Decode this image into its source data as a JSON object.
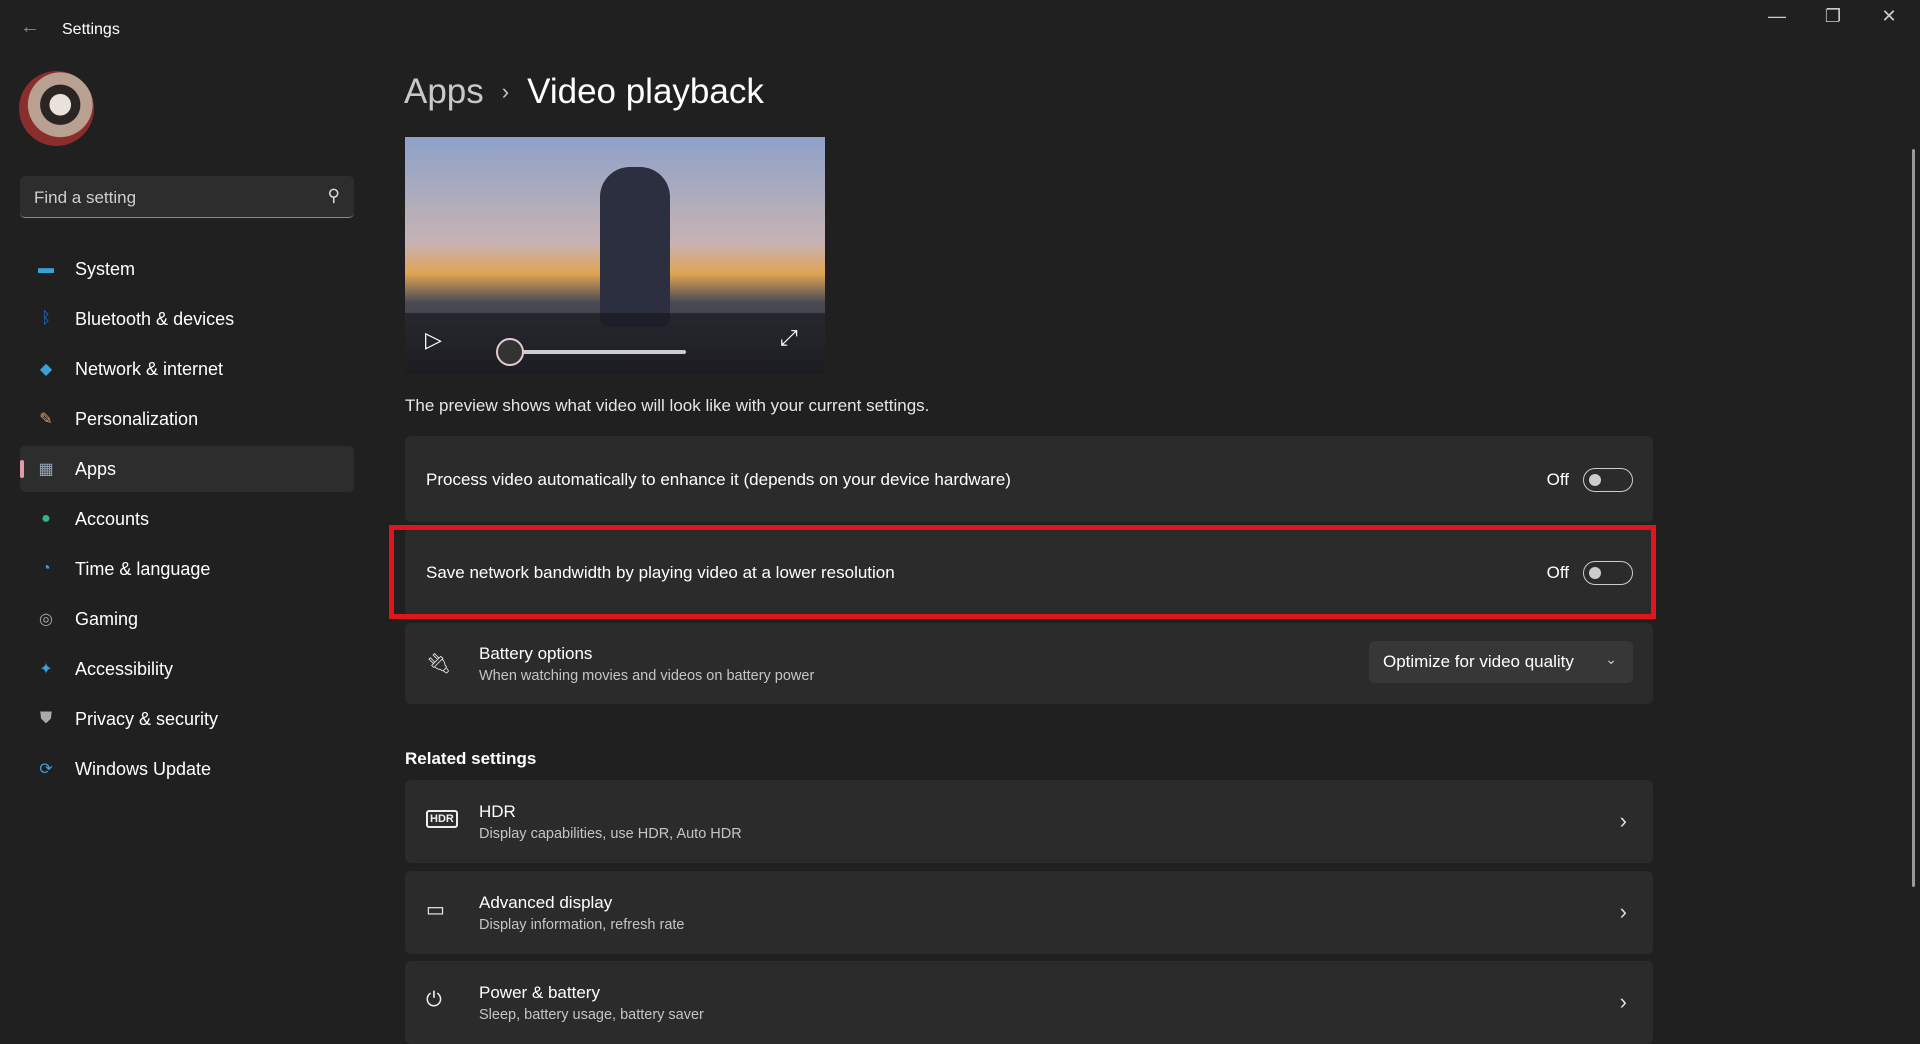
{
  "window": {
    "title": "Settings",
    "minimize": "—",
    "restore": "❐",
    "close": "✕"
  },
  "search": {
    "placeholder": "Find a setting"
  },
  "sidebar": {
    "items": [
      {
        "label": "System",
        "icon": "▬",
        "color": "#3aa0d8"
      },
      {
        "label": "Bluetooth & devices",
        "icon": "ᛒ",
        "color": "#1a73e8"
      },
      {
        "label": "Network & internet",
        "icon": "◆",
        "color": "#3aa0d8"
      },
      {
        "label": "Personalization",
        "icon": "✎",
        "color": "#e0a060"
      },
      {
        "label": "Apps",
        "icon": "▦",
        "color": "#9aa7b8"
      },
      {
        "label": "Accounts",
        "icon": "●",
        "color": "#36b38a"
      },
      {
        "label": "Time & language",
        "icon": "◔",
        "color": "#3aa0d8"
      },
      {
        "label": "Gaming",
        "icon": "◎",
        "color": "#aaaaaa"
      },
      {
        "label": "Accessibility",
        "icon": "✦",
        "color": "#3aa0d8"
      },
      {
        "label": "Privacy & security",
        "icon": "⛊",
        "color": "#aaaaaa"
      },
      {
        "label": "Windows Update",
        "icon": "⟳",
        "color": "#3aa0d8"
      }
    ],
    "selected": "Apps"
  },
  "breadcrumb": {
    "parent": "Apps",
    "current": "Video playback"
  },
  "video": {
    "progress": 0
  },
  "caption": "The preview shows what video will look like with your current settings.",
  "settings": [
    {
      "label": "Process video automatically to enhance it (depends on your device hardware)",
      "state": "Off"
    },
    {
      "label": "Save network bandwidth by playing video at a lower resolution",
      "state": "Off"
    }
  ],
  "battery": {
    "title": "Battery options",
    "subtitle": "When watching movies and videos on battery power",
    "value": "Optimize for video quality"
  },
  "related": {
    "heading": "Related settings",
    "items": [
      {
        "title": "HDR",
        "subtitle": "Display capabilities, use HDR, Auto HDR"
      },
      {
        "title": "Advanced display",
        "subtitle": "Display information, refresh rate"
      },
      {
        "title": "Power & battery",
        "subtitle": "Sleep, battery usage, battery saver"
      }
    ]
  },
  "colors": {
    "highlight": "#e0161e",
    "accent": "#e39aa6"
  }
}
